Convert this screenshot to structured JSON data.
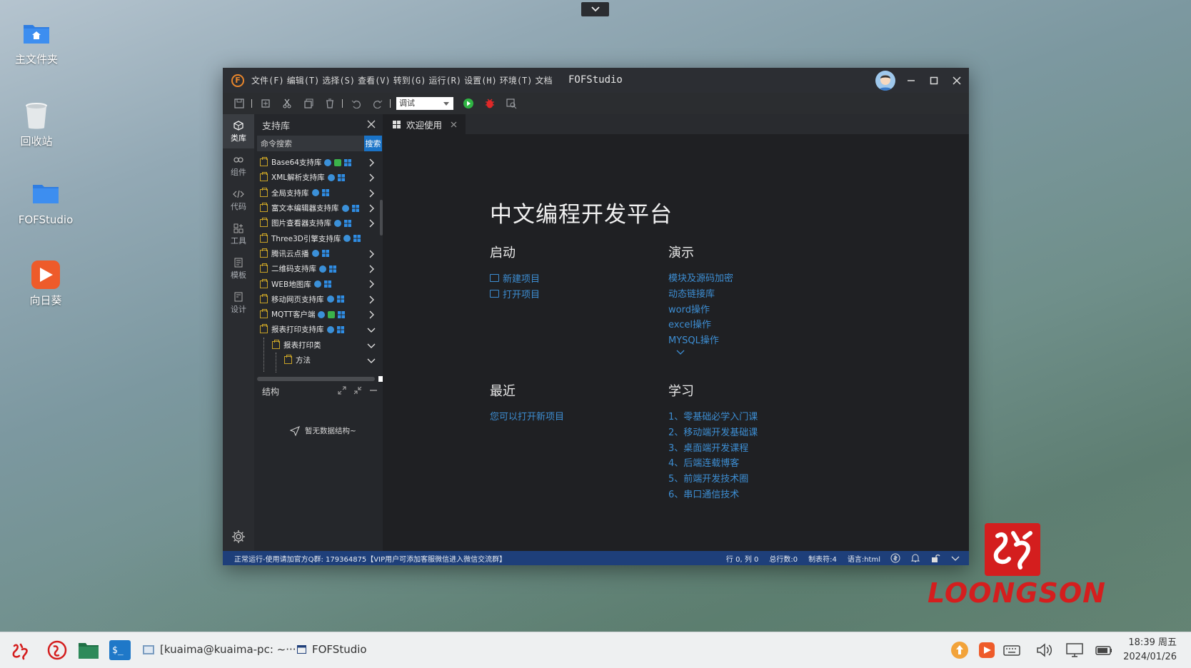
{
  "desktop": {
    "icons": [
      {
        "label": "主文件夹"
      },
      {
        "label": "回收站"
      },
      {
        "label": "FOFStudio"
      },
      {
        "label": "向日葵"
      }
    ]
  },
  "window": {
    "logo_letter": "F",
    "menu": [
      "文件(F)",
      "编辑(T)",
      "选择(S)",
      "查看(V)",
      "转到(G)",
      "运行(R)",
      "设置(H)",
      "环境(T)",
      "文档"
    ],
    "title": "FOFStudio"
  },
  "toolbar": {
    "build_mode": "调试"
  },
  "activity_bar": [
    {
      "label": "类库",
      "icon": "library-icon"
    },
    {
      "label": "组件",
      "icon": "component-icon"
    },
    {
      "label": "代码",
      "icon": "code-icon"
    },
    {
      "label": "工具",
      "icon": "tools-icon"
    },
    {
      "label": "模板",
      "icon": "template-icon"
    },
    {
      "label": "设计",
      "icon": "design-icon"
    }
  ],
  "sidebar": {
    "title": "支持库",
    "search_placeholder": "命令搜索",
    "search_button": "搜索",
    "libs": [
      {
        "name": "Base64支持库"
      },
      {
        "name": "XML解析支持库"
      },
      {
        "name": "全局支持库"
      },
      {
        "name": "富文本编辑器支持库"
      },
      {
        "name": "图片查看器支持库"
      },
      {
        "name": "Three3D引擎支持库"
      },
      {
        "name": "腾讯云点播"
      },
      {
        "name": "二维码支持库"
      },
      {
        "name": "WEB地图库"
      },
      {
        "name": "移动网页支持库"
      },
      {
        "name": "MQTT客户端"
      },
      {
        "name": "报表打印支持库"
      },
      {
        "name": "报表打印类"
      },
      {
        "name": "方法"
      }
    ],
    "structure_title": "结构",
    "no_data": "暂无数据结构~"
  },
  "editor": {
    "tab_label": "欢迎使用"
  },
  "welcome": {
    "title": "中文编程开发平台",
    "start": {
      "heading": "启动",
      "new_project": "新建项目",
      "open_project": "打开项目"
    },
    "demo": {
      "heading": "演示",
      "items": [
        "模块及源码加密",
        "动态链接库",
        "word操作",
        "excel操作",
        "MYSQL操作"
      ]
    },
    "recent": {
      "heading": "最近",
      "hint": "您可以打开新项目"
    },
    "learn": {
      "heading": "学习",
      "items": [
        "1、零基础必学入门课",
        "2、移动端开发基础课",
        "3、桌面端开发课程",
        "4、后端连载博客",
        "5、前端开发技术圈",
        "6、串口通信技术"
      ]
    }
  },
  "statusbar": {
    "left": "正常运行-使用请加官方Q群: 179364875【VIP用户可添加客服微信进入微信交流群】",
    "cursor": "行 0, 列 0",
    "lines": "总行数:0",
    "tabs": "制表符:4",
    "language": "语言:html"
  },
  "branding": {
    "text": "LOONGSON",
    "color": "#d41e1e"
  },
  "taskbar": {
    "terminal_task": "[kuaima@kuaima-pc: ~···",
    "app_task": "FOFStudio",
    "time": "18:39 周五",
    "date": "2024/01/26"
  },
  "colors": {
    "accent": "#1a73c7",
    "link": "#3d8ed3",
    "statusbar": "#1e3f7a"
  }
}
